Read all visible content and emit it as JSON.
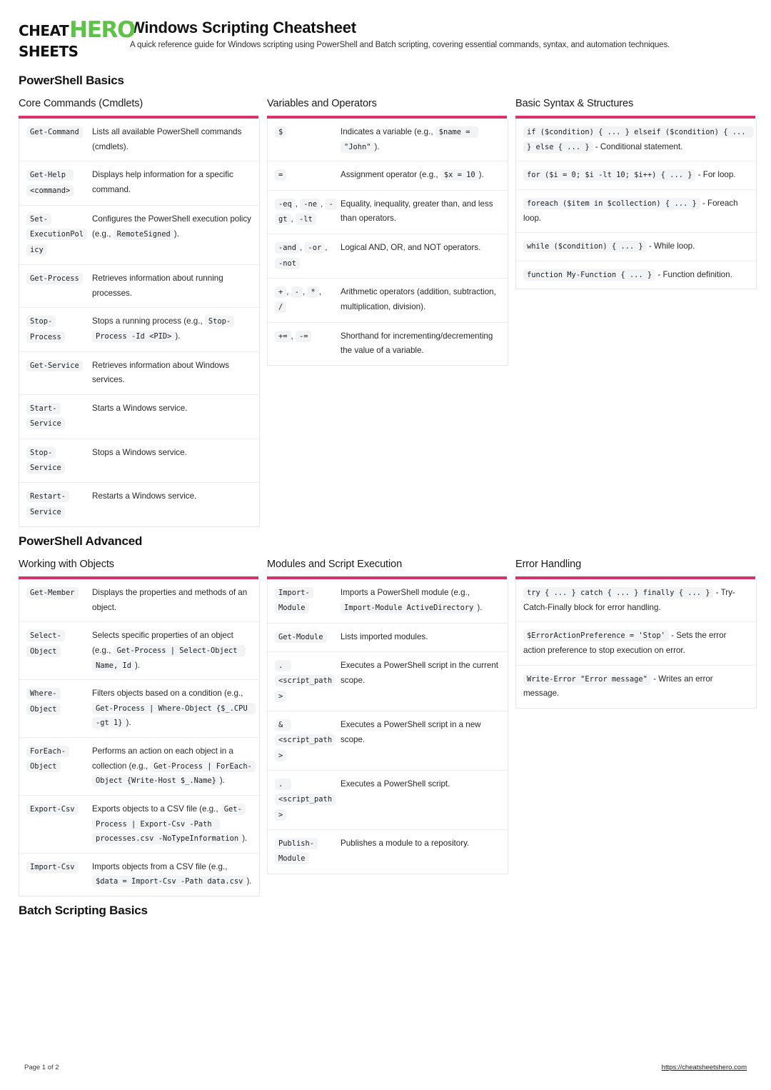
{
  "brand": {
    "line1": "CHEAT",
    "line2": "SHEETS",
    "hero": "HERO",
    "green": "#5cc345"
  },
  "header": {
    "title": "Windows Scripting Cheatsheet",
    "subtitle": "A quick reference guide for Windows scripting using PowerShell and Batch scripting, covering essential commands, syntax, and automation techniques."
  },
  "accent_color": "#d6336c",
  "sections": [
    {
      "title": "PowerShell Basics",
      "groups": [
        {
          "title": "Core Commands (Cmdlets)",
          "layout": "key-desc",
          "rows": [
            {
              "key": "Get-Command",
              "desc": [
                {
                  "t": "text",
                  "v": "Lists all available PowerShell commands (cmdlets)."
                }
              ]
            },
            {
              "key": "Get-Help <command>",
              "desc": [
                {
                  "t": "text",
                  "v": "Displays help information for a specific command."
                }
              ]
            },
            {
              "key": "Set-ExecutionPolicy",
              "desc": [
                {
                  "t": "text",
                  "v": "Configures the PowerShell execution policy (e.g., "
                },
                {
                  "t": "code",
                  "v": "RemoteSigned"
                },
                {
                  "t": "text",
                  "v": ")."
                }
              ]
            },
            {
              "key": "Get-Process",
              "desc": [
                {
                  "t": "text",
                  "v": "Retrieves information about running processes."
                }
              ]
            },
            {
              "key": "Stop-Process",
              "desc": [
                {
                  "t": "text",
                  "v": "Stops a running process (e.g., "
                },
                {
                  "t": "code",
                  "v": "Stop-Process -Id <PID>"
                },
                {
                  "t": "text",
                  "v": ")."
                }
              ]
            },
            {
              "key": "Get-Service",
              "desc": [
                {
                  "t": "text",
                  "v": "Retrieves information about Windows services."
                }
              ]
            },
            {
              "key": "Start-Service",
              "desc": [
                {
                  "t": "text",
                  "v": "Starts a Windows service."
                }
              ]
            },
            {
              "key": "Stop-Service",
              "desc": [
                {
                  "t": "text",
                  "v": "Stops a Windows service."
                }
              ]
            },
            {
              "key": "Restart-Service",
              "desc": [
                {
                  "t": "text",
                  "v": "Restarts a Windows service."
                }
              ]
            }
          ]
        },
        {
          "title": "Variables and Operators",
          "layout": "key-desc",
          "rows": [
            {
              "keyparts": [
                {
                  "t": "code",
                  "v": "$"
                }
              ],
              "desc": [
                {
                  "t": "text",
                  "v": "Indicates a variable (e.g., "
                },
                {
                  "t": "code",
                  "v": "$name = \"John\""
                },
                {
                  "t": "text",
                  "v": ")."
                }
              ]
            },
            {
              "keyparts": [
                {
                  "t": "code",
                  "v": "="
                }
              ],
              "desc": [
                {
                  "t": "text",
                  "v": "Assignment operator (e.g., "
                },
                {
                  "t": "code",
                  "v": "$x = 10"
                },
                {
                  "t": "text",
                  "v": ")."
                }
              ]
            },
            {
              "keyparts": [
                {
                  "t": "code",
                  "v": "-eq"
                },
                {
                  "t": "text",
                  "v": ", "
                },
                {
                  "t": "code",
                  "v": "-ne"
                },
                {
                  "t": "text",
                  "v": ", "
                },
                {
                  "t": "code",
                  "v": "-gt"
                },
                {
                  "t": "text",
                  "v": ", "
                },
                {
                  "t": "code",
                  "v": "-lt"
                }
              ],
              "desc": [
                {
                  "t": "text",
                  "v": "Equality, inequality, greater than, and less than operators."
                }
              ]
            },
            {
              "keyparts": [
                {
                  "t": "code",
                  "v": "-and"
                },
                {
                  "t": "text",
                  "v": ", "
                },
                {
                  "t": "code",
                  "v": "-or"
                },
                {
                  "t": "text",
                  "v": ", "
                },
                {
                  "t": "code",
                  "v": "-not"
                }
              ],
              "desc": [
                {
                  "t": "text",
                  "v": "Logical AND, OR, and NOT operators."
                }
              ]
            },
            {
              "keyparts": [
                {
                  "t": "code",
                  "v": "+"
                },
                {
                  "t": "text",
                  "v": ", "
                },
                {
                  "t": "code",
                  "v": "-"
                },
                {
                  "t": "text",
                  "v": ", "
                },
                {
                  "t": "code",
                  "v": "*"
                },
                {
                  "t": "text",
                  "v": ", "
                },
                {
                  "t": "code",
                  "v": "/"
                }
              ],
              "desc": [
                {
                  "t": "text",
                  "v": "Arithmetic operators (addition, subtraction, multiplication, division)."
                }
              ]
            },
            {
              "keyparts": [
                {
                  "t": "code",
                  "v": "+="
                },
                {
                  "t": "text",
                  "v": ", "
                },
                {
                  "t": "code",
                  "v": "-="
                }
              ],
              "desc": [
                {
                  "t": "text",
                  "v": "Shorthand for incrementing/decrementing the value of a variable."
                }
              ]
            }
          ]
        },
        {
          "title": "Basic Syntax & Structures",
          "layout": "full",
          "rows": [
            {
              "parts": [
                {
                  "t": "code",
                  "v": "if ($condition) { ... } elseif ($condition) { ... } else { ... }"
                },
                {
                  "t": "text",
                  "v": " - Conditional statement."
                }
              ]
            },
            {
              "parts": [
                {
                  "t": "code",
                  "v": "for ($i = 0; $i -lt 10; $i++) { ... }"
                },
                {
                  "t": "text",
                  "v": " - For loop."
                }
              ]
            },
            {
              "parts": [
                {
                  "t": "code",
                  "v": "foreach ($item in $collection) { ... }"
                },
                {
                  "t": "text",
                  "v": " - Foreach loop."
                }
              ]
            },
            {
              "parts": [
                {
                  "t": "code",
                  "v": "while ($condition) { ... }"
                },
                {
                  "t": "text",
                  "v": " - While loop."
                }
              ]
            },
            {
              "parts": [
                {
                  "t": "code",
                  "v": "function My-Function { ... }"
                },
                {
                  "t": "text",
                  "v": " - Function definition."
                }
              ]
            }
          ]
        }
      ]
    },
    {
      "title": "PowerShell Advanced",
      "groups": [
        {
          "title": "Working with Objects",
          "layout": "key-desc",
          "rows": [
            {
              "key": "Get-Member",
              "desc": [
                {
                  "t": "text",
                  "v": "Displays the properties and methods of an object."
                }
              ]
            },
            {
              "key": "Select-Object",
              "desc": [
                {
                  "t": "text",
                  "v": "Selects specific properties of an object (e.g., "
                },
                {
                  "t": "code",
                  "v": "Get-Process | Select-Object Name, Id"
                },
                {
                  "t": "text",
                  "v": ")."
                }
              ]
            },
            {
              "key": "Where-Object",
              "desc": [
                {
                  "t": "text",
                  "v": "Filters objects based on a condition (e.g., "
                },
                {
                  "t": "code",
                  "v": "Get-Process | Where-Object {$_.CPU -gt 1}"
                },
                {
                  "t": "text",
                  "v": ")."
                }
              ]
            },
            {
              "key": "ForEach-Object",
              "desc": [
                {
                  "t": "text",
                  "v": "Performs an action on each object in a collection (e.g., "
                },
                {
                  "t": "code",
                  "v": "Get-Process | ForEach-Object {Write-Host $_.Name}"
                },
                {
                  "t": "text",
                  "v": ")."
                }
              ]
            },
            {
              "key": "Export-Csv",
              "desc": [
                {
                  "t": "text",
                  "v": "Exports objects to a CSV file (e.g., "
                },
                {
                  "t": "code",
                  "v": "Get-Process | Export-Csv -Path processes.csv -NoTypeInformation"
                },
                {
                  "t": "text",
                  "v": ")."
                }
              ]
            },
            {
              "key": "Import-Csv",
              "desc": [
                {
                  "t": "text",
                  "v": "Imports objects from a CSV file (e.g., "
                },
                {
                  "t": "code",
                  "v": "$data = Import-Csv -Path data.csv"
                },
                {
                  "t": "text",
                  "v": ")."
                }
              ]
            }
          ]
        },
        {
          "title": "Modules and Script Execution",
          "layout": "key-desc",
          "rows": [
            {
              "key": "Import-Module",
              "desc": [
                {
                  "t": "text",
                  "v": "Imports a PowerShell module (e.g., "
                },
                {
                  "t": "code",
                  "v": "Import-Module ActiveDirectory"
                },
                {
                  "t": "text",
                  "v": ")."
                }
              ]
            },
            {
              "key": "Get-Module",
              "desc": [
                {
                  "t": "text",
                  "v": "Lists imported modules."
                }
              ]
            },
            {
              "key": ". <script_path>",
              "desc": [
                {
                  "t": "text",
                  "v": "Executes a PowerShell script in the current scope."
                }
              ]
            },
            {
              "key": "& <script_path>",
              "desc": [
                {
                  "t": "text",
                  "v": "Executes a PowerShell script in a new scope."
                }
              ]
            },
            {
              "key": ". <script_path>",
              "desc": [
                {
                  "t": "text",
                  "v": "Executes a PowerShell script."
                }
              ]
            },
            {
              "key": "Publish-Module",
              "desc": [
                {
                  "t": "text",
                  "v": "Publishes a module to a repository."
                }
              ]
            }
          ]
        },
        {
          "title": "Error Handling",
          "layout": "full",
          "rows": [
            {
              "parts": [
                {
                  "t": "code",
                  "v": "try { ... } catch { ... } finally { ... }"
                },
                {
                  "t": "text",
                  "v": " - Try-Catch-Finally block for error handling."
                }
              ]
            },
            {
              "parts": [
                {
                  "t": "code",
                  "v": "$ErrorActionPreference = 'Stop'"
                },
                {
                  "t": "text",
                  "v": " - Sets the error action preference to stop execution on error."
                }
              ]
            },
            {
              "parts": [
                {
                  "t": "code",
                  "v": "Write-Error \"Error message\""
                },
                {
                  "t": "text",
                  "v": " - Writes an error message."
                }
              ]
            }
          ]
        }
      ]
    },
    {
      "title": "Batch Scripting Basics",
      "groups": []
    }
  ],
  "footer": {
    "page_label": "Page 1 of 2",
    "site": "https://cheatsheetshero.com"
  }
}
